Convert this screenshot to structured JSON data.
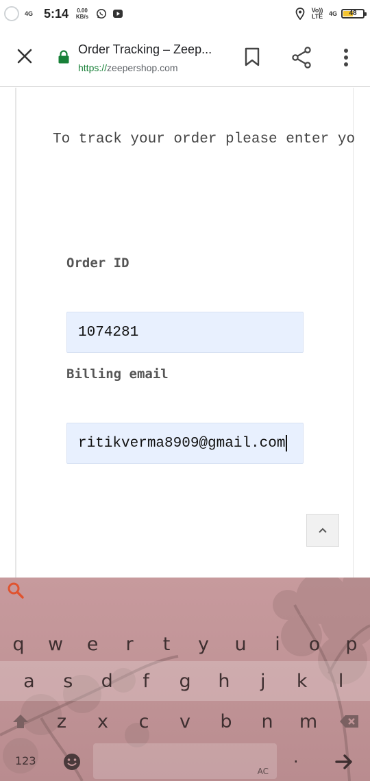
{
  "status_bar": {
    "signal_label": "4G",
    "time": "5:14",
    "net_speed": "0.00",
    "net_speed_unit": "KB/s",
    "volte_label": "Vo)) LTE",
    "network_label": "4G",
    "battery_level": "48",
    "battery_fraction": 0.48
  },
  "toolbar": {
    "title": "Order Tracking – Zeep...",
    "url_scheme": "https://",
    "url_host": "zeepershop.com",
    "icons": [
      "close-icon",
      "lock-icon",
      "bookmark-icon",
      "share-icon",
      "more-vert-icon"
    ]
  },
  "page": {
    "intro_text": "To track your order please enter yo",
    "order_id_label": "Order ID",
    "order_id_value": "1074281",
    "billing_email_label": "Billing email",
    "billing_email_value": "ritikverma8909@gmail.com",
    "scroll_top_icon": "chevron-up-icon"
  },
  "keyboard": {
    "row1": [
      "q",
      "w",
      "e",
      "r",
      "t",
      "y",
      "u",
      "i",
      "o",
      "p"
    ],
    "row2": [
      "a",
      "s",
      "d",
      "f",
      "g",
      "h",
      "j",
      "k",
      "l"
    ],
    "row3": [
      "z",
      "x",
      "c",
      "v",
      "b",
      "n",
      "m"
    ],
    "numbers_key": "123",
    "period_key": ".",
    "space_badge": "AC",
    "accent_color": "#e0532f",
    "background_color": "#c29598"
  }
}
